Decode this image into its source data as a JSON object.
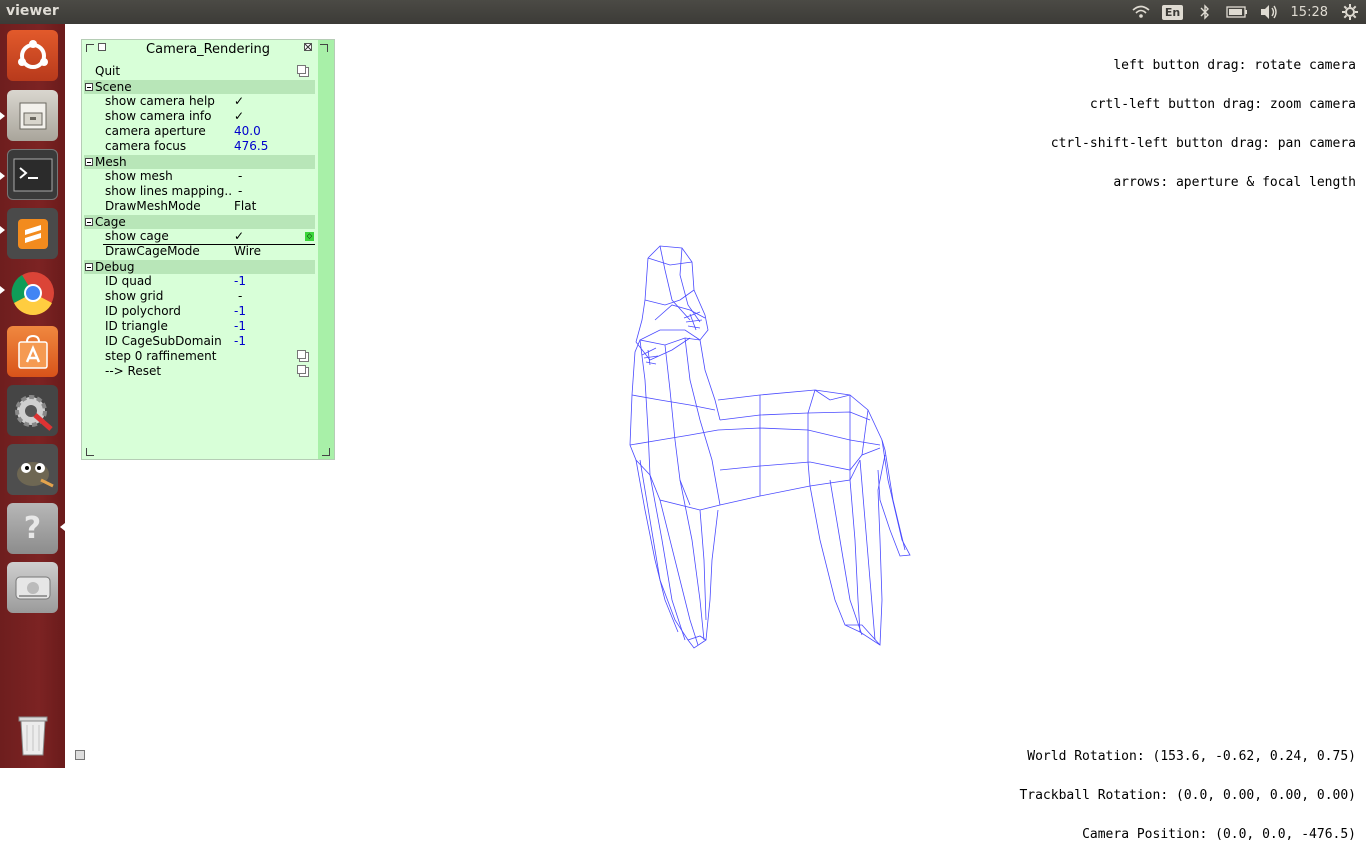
{
  "window": {
    "title": "viewer"
  },
  "tray": {
    "lang": "En",
    "clock": "15:28"
  },
  "launcher": {
    "items": [
      {
        "name": "ubuntu-dash"
      },
      {
        "name": "files"
      },
      {
        "name": "terminal"
      },
      {
        "name": "sublime-text"
      },
      {
        "name": "chrome"
      },
      {
        "name": "software-center"
      },
      {
        "name": "system-settings"
      },
      {
        "name": "gimp"
      },
      {
        "name": "help"
      },
      {
        "name": "disk"
      },
      {
        "name": "trash"
      }
    ]
  },
  "gui": {
    "title": "Camera_Rendering",
    "quit": "Quit",
    "groups": {
      "scene": "Scene",
      "mesh": "Mesh",
      "cage": "Cage",
      "debug": "Debug"
    },
    "rows": {
      "show_camera_help": {
        "label": "show camera help",
        "value": "✓"
      },
      "show_camera_info": {
        "label": "show camera info",
        "value": "✓"
      },
      "camera_aperture": {
        "label": "camera aperture",
        "value": "40.0"
      },
      "camera_focus": {
        "label": "camera focus",
        "value": "476.5"
      },
      "show_mesh": {
        "label": "show mesh",
        "value": "-"
      },
      "show_lines_mapping": {
        "label": "show lines mapping..",
        "value": "-"
      },
      "draw_mesh_mode": {
        "label": "DrawMeshMode",
        "value": "Flat"
      },
      "show_cage": {
        "label": "show cage",
        "value": "✓"
      },
      "draw_cage_mode": {
        "label": "DrawCageMode",
        "value": "Wire"
      },
      "id_quad": {
        "label": "ID quad",
        "value": "-1"
      },
      "show_grid": {
        "label": "show grid",
        "value": "-"
      },
      "id_polychord": {
        "label": "ID polychord",
        "value": "-1"
      },
      "id_triangle": {
        "label": "ID triangle",
        "value": "-1"
      },
      "id_cage_subdomain": {
        "label": "ID CageSubDomain",
        "value": "-1"
      },
      "step_raffinement": {
        "label": "step 0 raffinement"
      },
      "reset": {
        "label": "--> Reset"
      }
    }
  },
  "help": {
    "line1": "left button drag: rotate camera",
    "line2": "crtl-left button drag: zoom camera",
    "line3": "ctrl-shift-left button drag: pan camera",
    "line4": "arrows: aperture & focal length"
  },
  "info": {
    "world_rotation": "World Rotation: (153.6, -0.62, 0.24, 0.75)",
    "trackball_rotation": "Trackball Rotation: (0.0, 0.00, 0.00, 0.00)",
    "camera_position": "Camera Position: (0.0, 0.0, -476.5)"
  },
  "colors": {
    "panel_bg": "#d8ffd8",
    "wireframe": "#4a4aff",
    "launcher_bg": "#7c2323"
  }
}
